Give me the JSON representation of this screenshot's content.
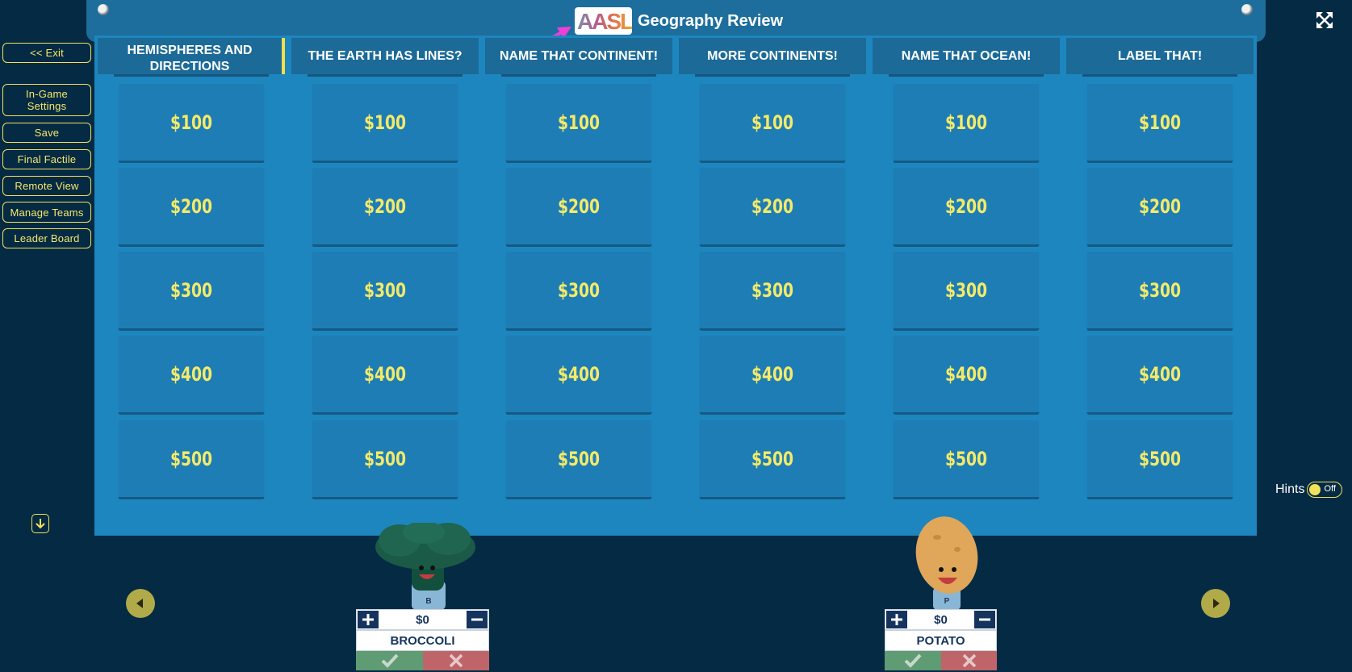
{
  "sidebar": {
    "exit": "<< Exit",
    "settings": "In-Game Settings",
    "save": "Save",
    "final": "Final Factile",
    "remote": "Remote View",
    "teams": "Manage Teams",
    "leader": "Leader Board"
  },
  "header": {
    "logo": "AASL",
    "title": "Geography Review"
  },
  "categories": [
    "HEMISPHERES AND DIRECTIONS",
    "THE EARTH HAS LINES?",
    "NAME THAT CONTINENT!",
    "MORE CONTINENTS!",
    "NAME THAT OCEAN!",
    "LABEL THAT!"
  ],
  "values": [
    "$100",
    "$200",
    "$300",
    "$400",
    "$500"
  ],
  "hints": {
    "label": "Hints",
    "state": "Off"
  },
  "teams": [
    {
      "name": "BROCCOLI",
      "score": "$0",
      "badge": "B"
    },
    {
      "name": "POTATO",
      "score": "$0",
      "badge": "P"
    }
  ],
  "colors": {
    "background": "#052a44",
    "board": "#1d86bf",
    "tile": "#1e7db4",
    "accent_yellow": "#f4ea6a",
    "team_navy": "#14345e"
  }
}
